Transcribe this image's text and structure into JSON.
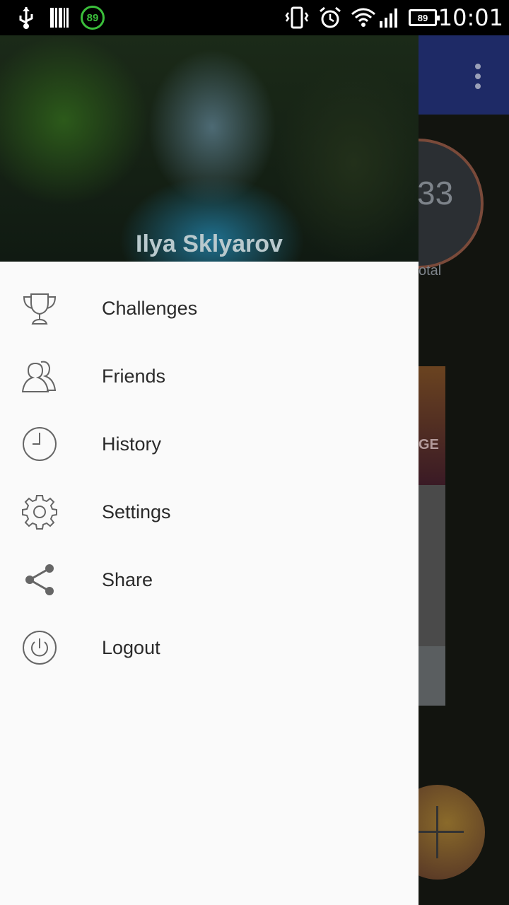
{
  "status_bar": {
    "time": "10:01",
    "notification_badge": "89",
    "battery_level": "89",
    "icons": [
      "usb-icon",
      "barcode-icon",
      "badge-icon",
      "vibrate-icon",
      "alarm-icon",
      "wifi-icon",
      "signal-icon",
      "battery-icon"
    ]
  },
  "drawer": {
    "user_name": "Ilya Sklyarov",
    "items": [
      {
        "label": "Challenges",
        "icon": "trophy-icon"
      },
      {
        "label": "Friends",
        "icon": "friends-icon"
      },
      {
        "label": "History",
        "icon": "clock-icon"
      },
      {
        "label": "Settings",
        "icon": "gear-icon"
      },
      {
        "label": "Share",
        "icon": "share-icon"
      },
      {
        "label": "Logout",
        "icon": "power-icon"
      }
    ]
  },
  "background_app": {
    "stat_number": "33",
    "stat_caption": "otal",
    "card_text": "GE"
  },
  "colors": {
    "app_bar": "#1e2a66",
    "drawer_bg": "#fafafa",
    "badge_green": "#3bbf3b"
  }
}
